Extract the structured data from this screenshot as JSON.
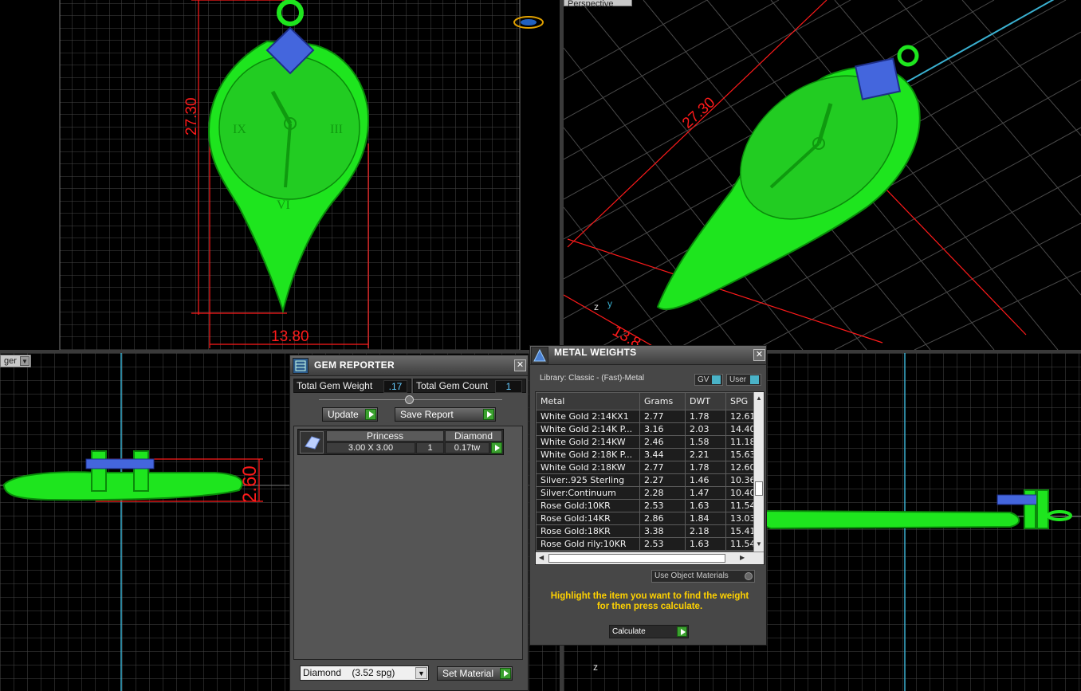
{
  "viewports": {
    "top_left": {
      "dim_height": "27.30",
      "dim_width": "13.80"
    },
    "top_right": {
      "tab_label": "Perspective",
      "dim_length": "27.30",
      "dim_width": "13.8",
      "axis_z": "z",
      "axis_y": "y"
    },
    "bottom_left": {
      "tab_label": "ger",
      "dim_height": "2.60"
    },
    "bottom_right": {
      "axis_z": "z"
    }
  },
  "gem_reporter": {
    "title": "GEM REPORTER",
    "total_gem_weight_label": "Total Gem Weight",
    "total_gem_weight_value": ".17",
    "total_gem_count_label": "Total Gem Count",
    "total_gem_count_value": "1",
    "update_label": "Update",
    "save_report_label": "Save Report",
    "gem_row": {
      "shape_header": "Princess",
      "type_header": "Diamond",
      "size": "3.00 X 3.00",
      "count": "1",
      "weight": "0.17tw"
    },
    "material_select": "Diamond    (3.52 spg)",
    "set_material_label": "Set Material"
  },
  "metal_weights": {
    "title": "METAL WEIGHTS",
    "library_label": "Library: Classic - (Fast)-Metal",
    "gv_label": "GV",
    "user_label": "User",
    "columns": [
      "Metal",
      "Grams",
      "DWT",
      "SPG"
    ],
    "rows": [
      [
        "White Gold 2:14KX1",
        "2.77",
        "1.78",
        "12.61"
      ],
      [
        "White Gold 2:14K P...",
        "3.16",
        "2.03",
        "14.40"
      ],
      [
        "White Gold 2:14KW",
        "2.46",
        "1.58",
        "11.18"
      ],
      [
        "White Gold 2:18K P...",
        "3.44",
        "2.21",
        "15.63"
      ],
      [
        "White Gold 2:18KW",
        "2.77",
        "1.78",
        "12.60"
      ],
      [
        "Silver:.925 Sterling",
        "2.27",
        "1.46",
        "10.36"
      ],
      [
        "Silver:Continuum",
        "2.28",
        "1.47",
        "10.40"
      ],
      [
        "Rose Gold:10KR",
        "2.53",
        "1.63",
        "11.54"
      ],
      [
        "Rose Gold:14KR",
        "2.86",
        "1.84",
        "13.03"
      ],
      [
        "Rose Gold:18KR",
        "3.38",
        "2.18",
        "15.41"
      ],
      [
        "Rose Gold rily:10KR",
        "2.53",
        "1.63",
        "11.54"
      ]
    ],
    "use_object_materials_label": "Use Object Materials",
    "hint_line1": "Highlight the item you want to find the weight",
    "hint_line2": "for then press calculate.",
    "calculate_label": "Calculate"
  },
  "colors": {
    "model_green": "#1ee51e",
    "gem_blue": "#4466dd",
    "dimension_red": "#ff1a1a",
    "grid": "#555555",
    "hint_yellow": "#ffd200"
  }
}
